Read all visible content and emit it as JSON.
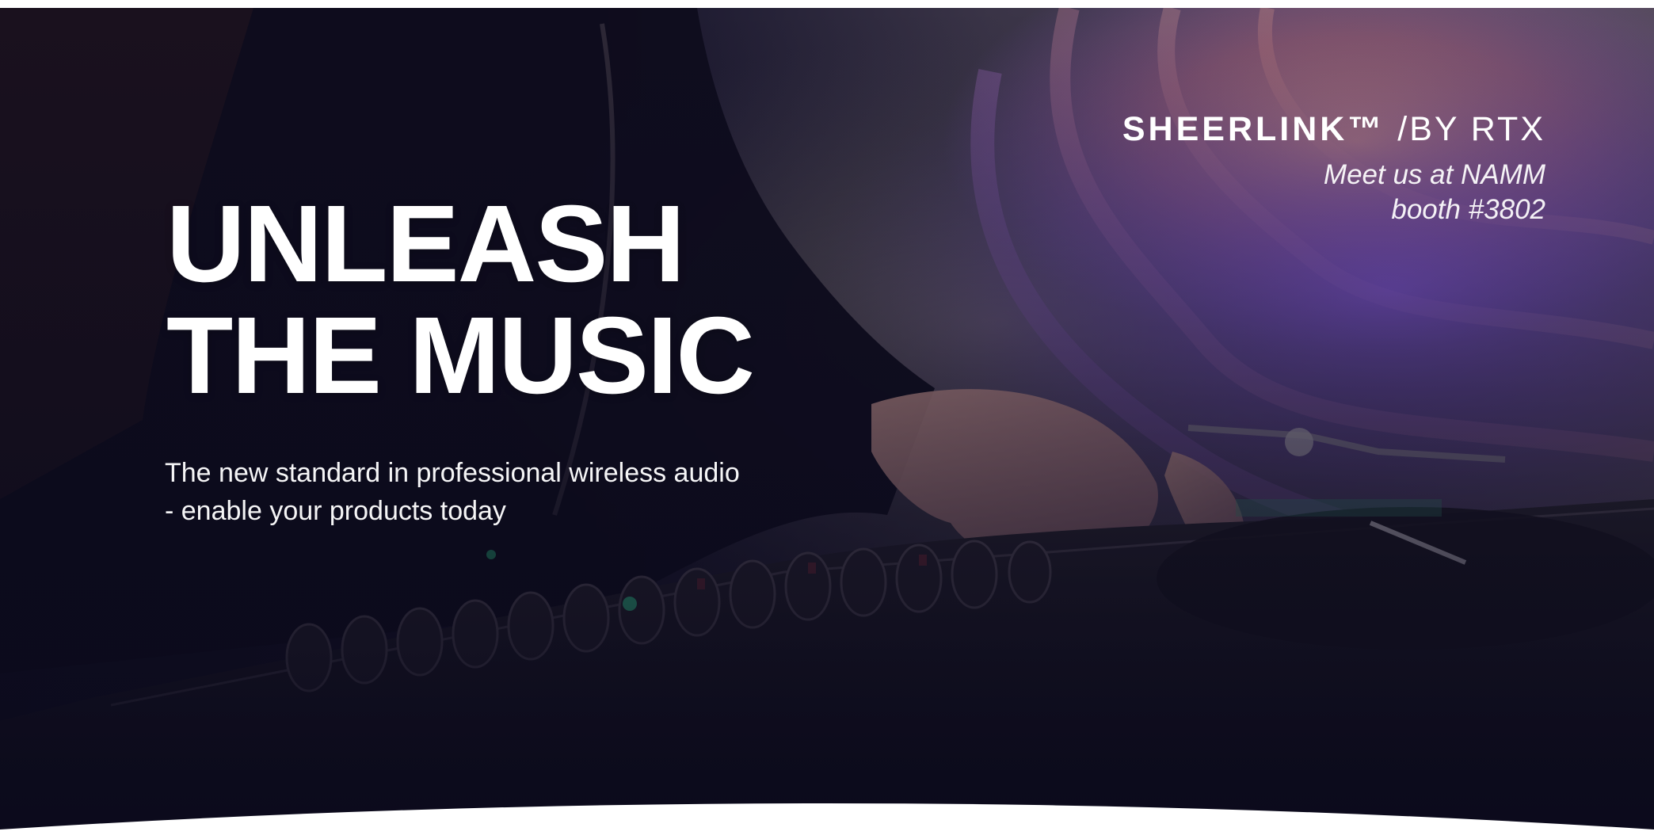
{
  "hero": {
    "headline_lines": [
      "UNLEASH",
      "THE MUSIC"
    ],
    "subtext_lines": [
      "The new standard in professional wireless audio",
      "- enable your products today"
    ]
  },
  "brand": {
    "name": "SHEERLINK™",
    "by": "/BY RTX",
    "tagline_lines": [
      "Meet us at NAMM",
      "booth #3802"
    ]
  },
  "colors": {
    "text": "#ffffff",
    "background_dark": "#0b0a1c",
    "accent_purple": "#7d52c4",
    "accent_orange": "#e0915e",
    "page_background": "#ffffff"
  },
  "icons": {
    "hero_photo": "dj-mixing-console-photo",
    "bottom_wave": "white-curve-divider"
  }
}
